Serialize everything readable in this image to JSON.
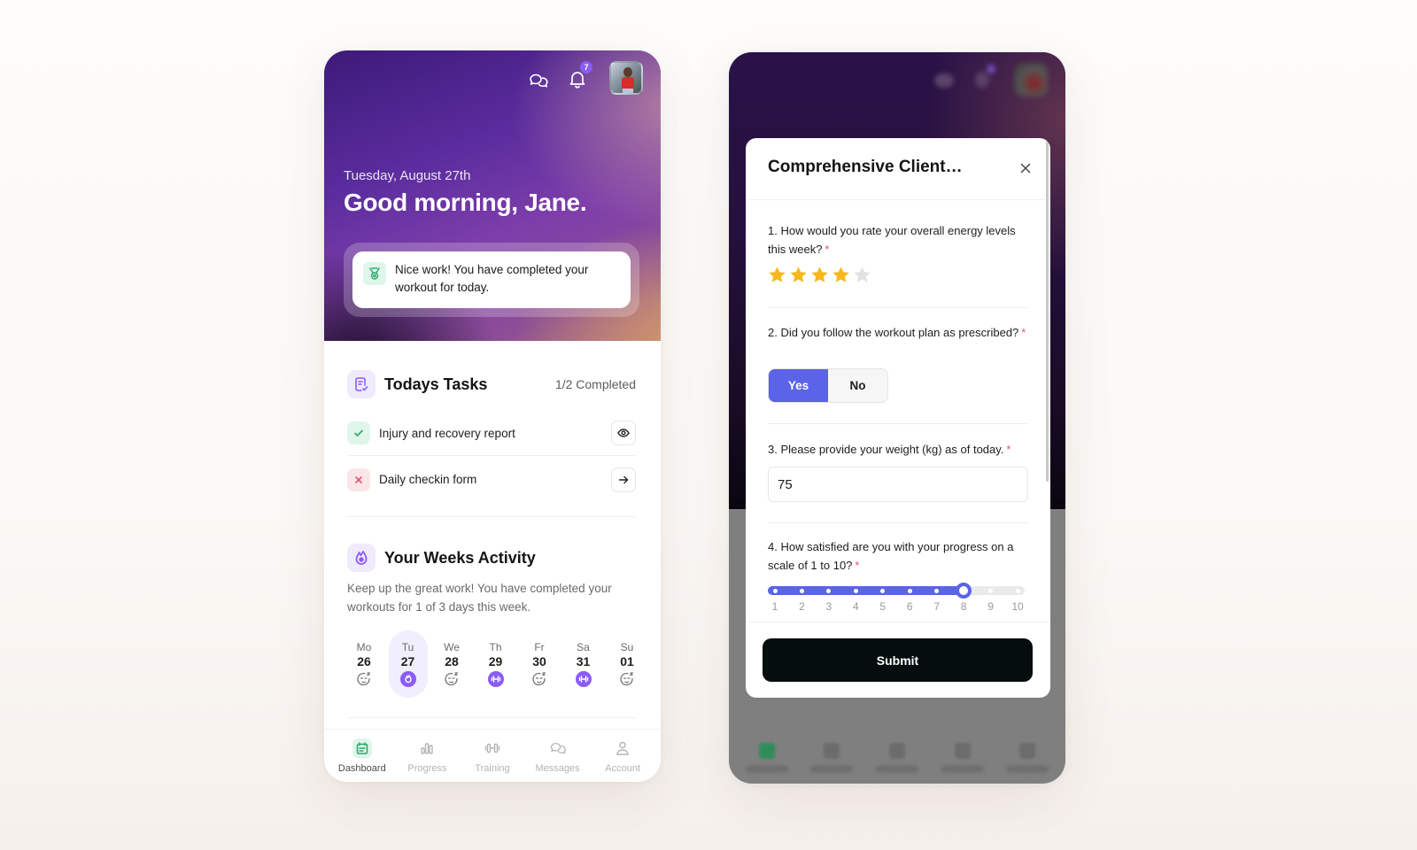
{
  "left_phone": {
    "header": {
      "messages_icon": "chat-bubbles-icon",
      "notifications_icon": "bell-icon",
      "notification_count": "7",
      "avatar": "user-avatar-photo"
    },
    "hero": {
      "date": "Tuesday, August 27th",
      "greeting": "Good morning, Jane.",
      "banner_icon": "medal-icon",
      "banner_text": "Nice work! You have completed your workout for today."
    },
    "tasks": {
      "title": "Todays Tasks",
      "icon": "checklist-icon",
      "progress": "1/2 Completed",
      "items": [
        {
          "label": "Injury and recovery report",
          "status": "completed",
          "status_icon": "check-icon",
          "action_icon": "eye-icon"
        },
        {
          "label": "Daily checkin form",
          "status": "not-completed",
          "status_icon": "x-icon",
          "action_icon": "arrow-right-icon"
        }
      ]
    },
    "activity": {
      "title": "Your Weeks Activity",
      "icon": "flame-icon",
      "description": "Keep up the great work! You have completed your workouts for 1 of 3 days this week.",
      "days": [
        {
          "name": "Mo",
          "date": "26",
          "icon": "rest-face-icon",
          "selected": false
        },
        {
          "name": "Tu",
          "date": "27",
          "icon": "completed-workout-icon",
          "selected": true
        },
        {
          "name": "We",
          "date": "28",
          "icon": "rest-face-icon",
          "selected": false
        },
        {
          "name": "Th",
          "date": "29",
          "icon": "dumbbell-icon",
          "selected": false
        },
        {
          "name": "Fr",
          "date": "30",
          "icon": "rest-face-icon",
          "selected": false
        },
        {
          "name": "Sa",
          "date": "31",
          "icon": "dumbbell-icon",
          "selected": false
        },
        {
          "name": "Su",
          "date": "01",
          "icon": "rest-face-icon",
          "selected": false
        }
      ]
    },
    "nav": [
      {
        "label": "Dashboard",
        "icon": "calendar-icon",
        "active": true
      },
      {
        "label": "Progress",
        "icon": "bar-chart-icon",
        "active": false
      },
      {
        "label": "Training",
        "icon": "dumbbell-icon",
        "active": false
      },
      {
        "label": "Messages",
        "icon": "chat-bubbles-icon",
        "active": false
      },
      {
        "label": "Account",
        "icon": "user-icon",
        "active": false
      }
    ]
  },
  "modal": {
    "title": "Comprehensive Client…",
    "close_icon": "close-icon",
    "required_marker": "*",
    "questions": [
      {
        "number": "1.",
        "text": "How would you rate your overall energy levels this week?",
        "type": "rating",
        "value": 4,
        "max": 5
      },
      {
        "number": "2.",
        "text": "Did you follow the workout plan as prescribed?",
        "type": "yes-no",
        "options": [
          "Yes",
          "No"
        ],
        "selected": "Yes"
      },
      {
        "number": "3.",
        "text": "Please provide your weight (kg) as of today.",
        "type": "number",
        "value": "75"
      },
      {
        "number": "4.",
        "text": "How satisfied are you with your progress on a scale of 1 to 10?",
        "type": "scale",
        "min": 1,
        "max": 10,
        "value": 8,
        "labels": [
          "1",
          "2",
          "3",
          "4",
          "5",
          "6",
          "7",
          "8",
          "9",
          "10"
        ]
      }
    ],
    "submit_label": "Submit"
  },
  "colors": {
    "accent": "#5b63e8",
    "purple": "#8b5cf6",
    "success": "#2fa86a",
    "danger": "#e4526b",
    "star": "#f7b81c"
  }
}
